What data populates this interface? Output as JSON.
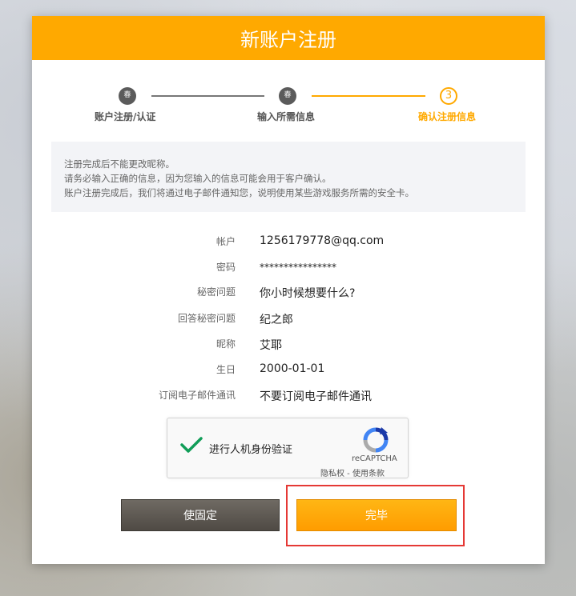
{
  "header": {
    "title": "新账户注册"
  },
  "steps": [
    {
      "label": "账户注册/认证",
      "icon": "checked-icon",
      "state": "done",
      "icon_text": "春"
    },
    {
      "label": "输入所需信息",
      "icon": "checked-icon",
      "state": "done",
      "icon_text": "春"
    },
    {
      "label": "确认注册信息",
      "number": "3",
      "state": "active"
    }
  ],
  "notice": [
    "注册完成后不能更改昵称。",
    "请务必输入正确的信息，因为您输入的信息可能会用于客户确认。",
    "账户注册完成后，我们将通过电子邮件通知您，说明使用某些游戏服务所需的安全卡。"
  ],
  "fields": [
    {
      "label": "帐户",
      "value": "1256179778@qq.com"
    },
    {
      "label": "密码",
      "value": "****************"
    },
    {
      "label": "秘密问题",
      "value": "你小时候想要什么?"
    },
    {
      "label": "回答秘密问题",
      "value": "纪之郎"
    },
    {
      "label": "昵称",
      "value": "艾耶"
    },
    {
      "label": "生日",
      "value": "2000-01-01"
    },
    {
      "label": "订阅电子邮件通讯",
      "value": "不要订阅电子邮件通讯"
    }
  ],
  "captcha": {
    "text": "进行人机身份验证",
    "brand": "reCAPTCHA",
    "privacy": "隐私权",
    "separator": " - ",
    "terms": "使用条款",
    "checked": true
  },
  "buttons": {
    "back": "使固定",
    "finish": "完毕"
  },
  "colors": {
    "accent": "#ffa900",
    "highlight": "#e53935",
    "check": "#109d58"
  }
}
